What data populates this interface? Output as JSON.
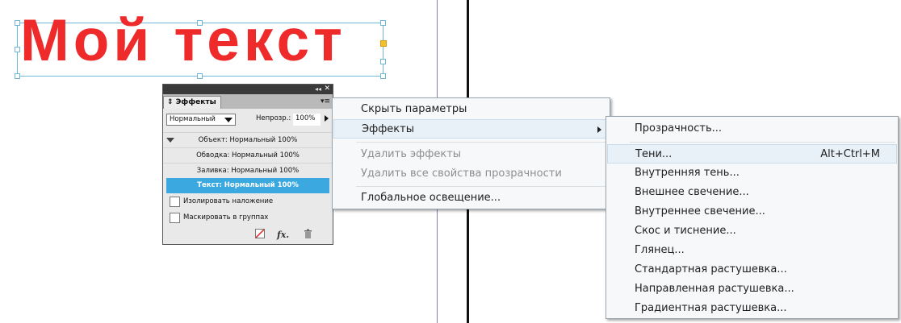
{
  "canvas": {
    "text_frame": {
      "text": "Мой текст",
      "color": "#ee2a2a"
    }
  },
  "effects_panel": {
    "tab_label": "Эффекты",
    "blend_mode": "Нормальный",
    "opacity_label": "Непрозр.:",
    "opacity_value": "100%",
    "rows": [
      "Объект: Нормальный 100%",
      "Обводка: Нормальный 100%",
      "Заливка: Нормальный 100%",
      "Текст: Нормальный 100%"
    ],
    "selected_row_index": 3,
    "checkboxes": [
      "Изолировать наложение",
      "Маскировать в группах"
    ],
    "bottom_icons": [
      "clear-effects-icon",
      "fx-icon",
      "trash-icon"
    ],
    "selection_color": "#3ba8e0"
  },
  "context_menu": {
    "items": [
      "Скрыть параметры",
      "Эффекты",
      "Удалить эффекты",
      "Удалить все свойства прозрачности",
      "Глобальное освещение..."
    ]
  },
  "effects_submenu": {
    "items": [
      "Прозрачность...",
      "Тени...",
      "Внутренняя тень...",
      "Внешнее свечение...",
      "Внутреннее свечение...",
      "Скос и тиснение...",
      "Глянец...",
      "Стандартная растушевка...",
      "Направленная растушевка...",
      "Градиентная растушевка..."
    ],
    "shadow_shortcut": "Alt+Ctrl+M"
  }
}
